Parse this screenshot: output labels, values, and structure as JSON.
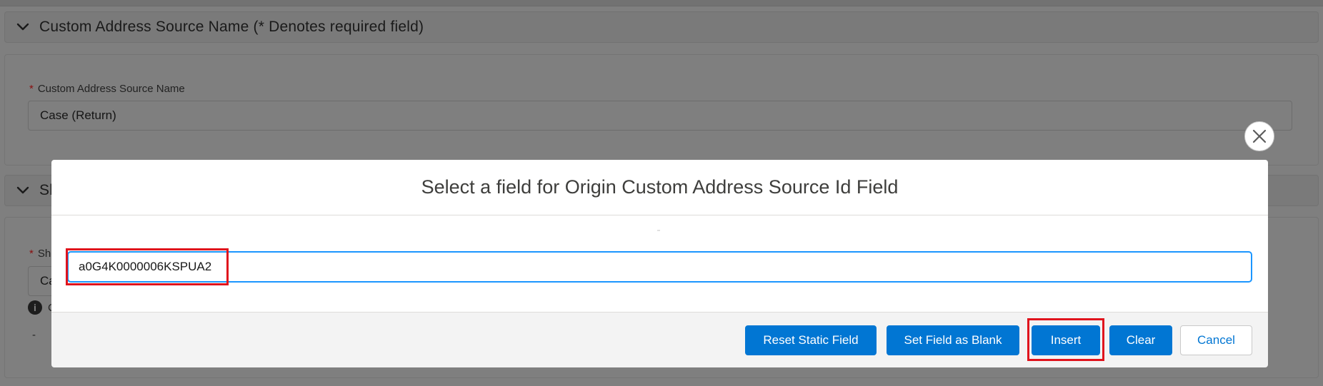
{
  "background": {
    "section1": {
      "title": "Custom Address Source Name (* Denotes required field)",
      "field_required_mark": "*",
      "field_label": "Custom Address Source Name",
      "field_value": "Case (Return)"
    },
    "section2": {
      "title_visible": "Sh",
      "field_required_mark": "*",
      "field_label_visible": "Sh",
      "field_value_visible": "Ca",
      "help_text_visible": "C",
      "dash": "-"
    }
  },
  "modal": {
    "title": "Select a field for Origin Custom Address Source Id Field",
    "input_value": "a0G4K0000006KSPUA2",
    "buttons": {
      "reset_static_field": "Reset Static Field",
      "set_field_as_blank": "Set Field as Blank",
      "insert": "Insert",
      "clear": "Clear",
      "cancel": "Cancel"
    }
  },
  "colors": {
    "brand": "#0176d3",
    "highlight": "#e0141d",
    "input_focus": "#1b96ff"
  },
  "icons": {
    "section_toggle": "chevron-down-icon",
    "close": "close-icon",
    "info": "info-icon"
  }
}
